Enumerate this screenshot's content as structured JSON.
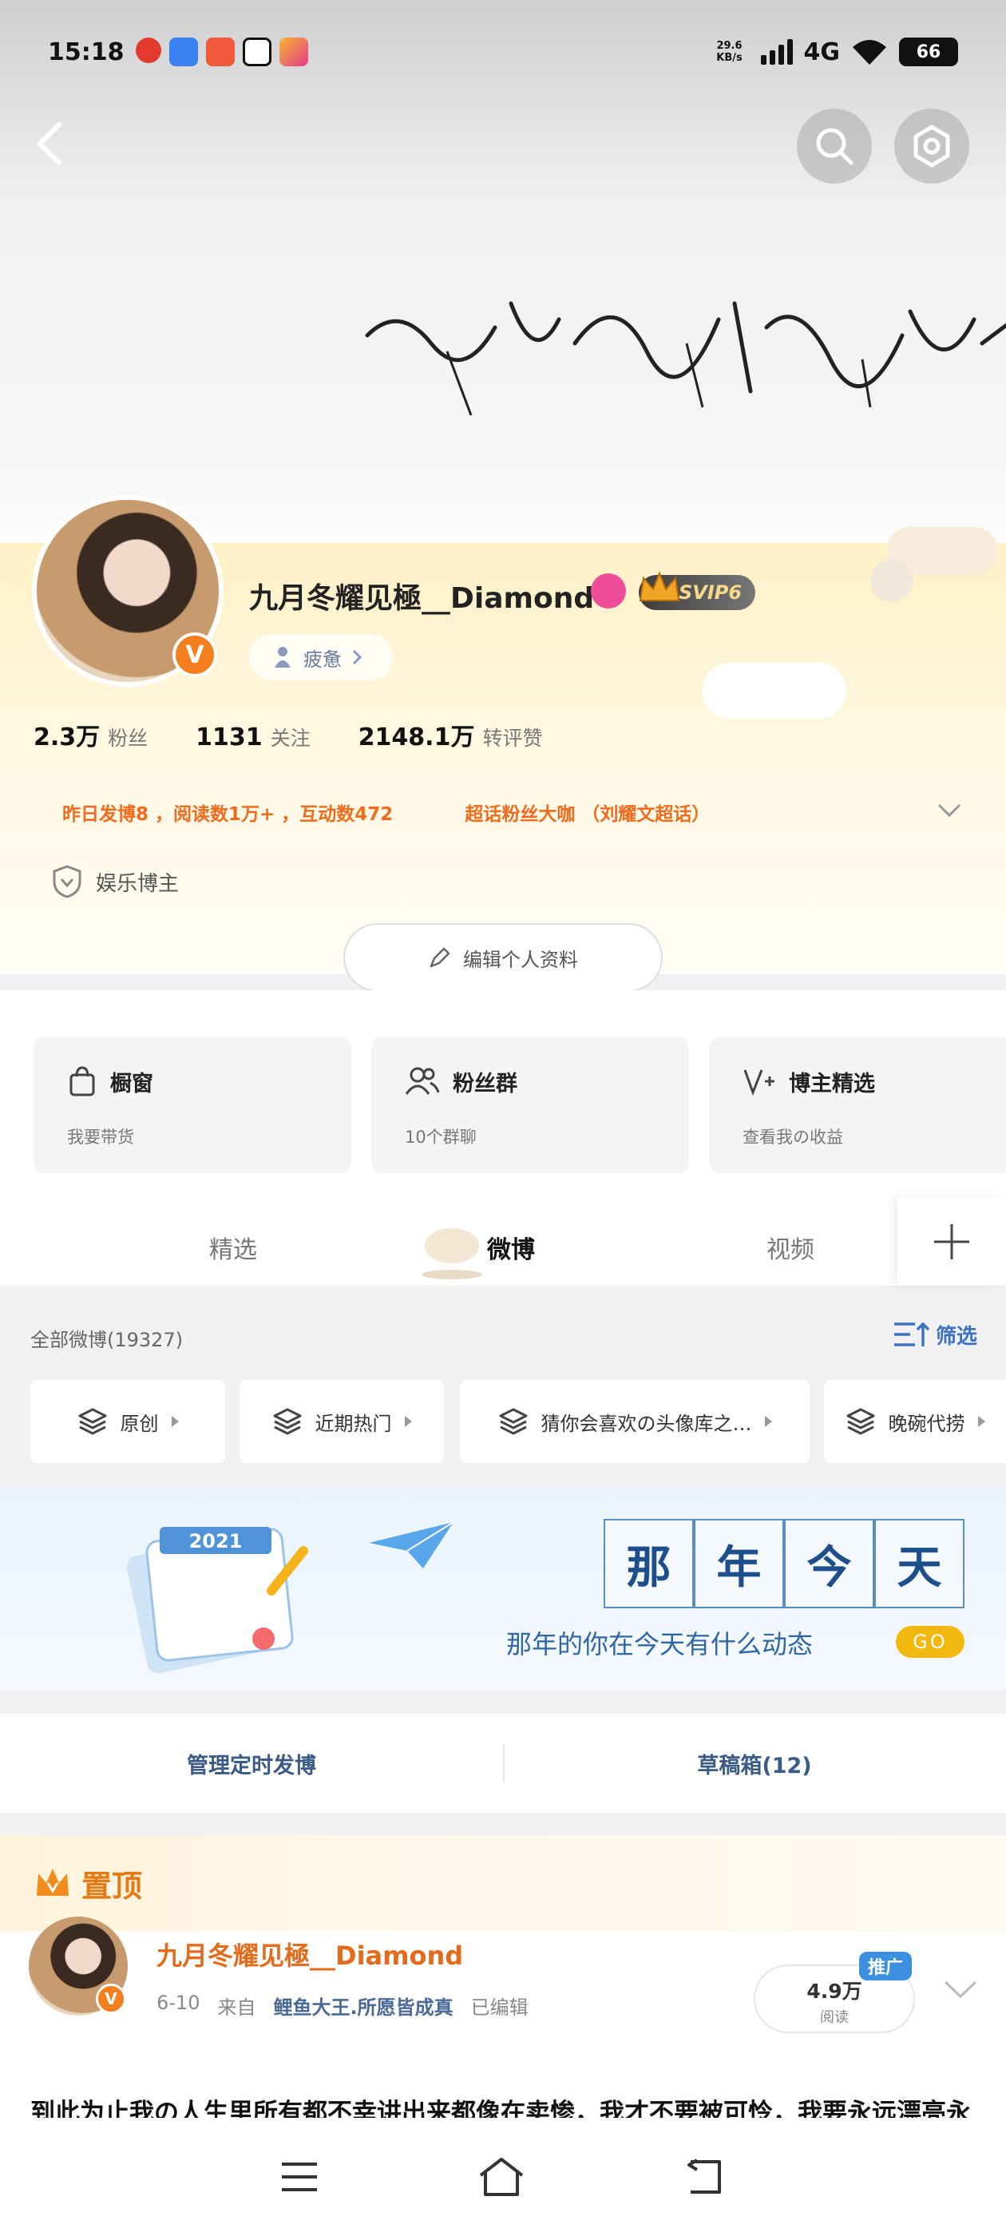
{
  "status_bar": {
    "time": "15:18",
    "net_speed_value": "29.6",
    "net_speed_unit": "KB/s",
    "network": "4G",
    "battery": "66"
  },
  "header": {
    "back_icon": "chevron-left-icon",
    "search_icon": "search-icon",
    "settings_icon": "gear-icon",
    "cover_calligraphy": "我想怎样就怎样"
  },
  "profile": {
    "name": "九月冬耀见極__Diamond",
    "vip_label": "SVIP6",
    "mood_label": "疲惫",
    "stats": [
      {
        "value": "2.3万",
        "label": "粉丝"
      },
      {
        "value": "1131",
        "label": "关注"
      },
      {
        "value": "2148.1万",
        "label": "转评赞"
      }
    ],
    "activity": "昨日发博8 ，阅读数1万+ ，互动数472",
    "super_topic": "超话粉丝大咖 （刘耀文超话）",
    "category": "娱乐博主",
    "edit_button": "编辑个人资料"
  },
  "cards": [
    {
      "title": "橱窗",
      "subtitle": "我要带货",
      "icon": "shopping-bag-icon"
    },
    {
      "title": "粉丝群",
      "subtitle": "10个群聊",
      "icon": "group-icon"
    },
    {
      "title": "博主精选",
      "subtitle": "查看我の收益",
      "icon": "verified-pen-icon"
    }
  ],
  "tabs": {
    "items": [
      "精选",
      "微博",
      "视频"
    ],
    "active": "微博"
  },
  "feed": {
    "total_label": "全部微博(19327)",
    "filter_label": "筛选",
    "chips": [
      "原创",
      "近期热门",
      "猜你会喜欢の头像库之…",
      "晚碗代捞"
    ]
  },
  "banner": {
    "year": "2021",
    "title_chars": [
      "那",
      "年",
      "今",
      "天"
    ],
    "subtitle": "那年的你在今天有什么动态",
    "go": "GO"
  },
  "manage": {
    "scheduled": "管理定时发博",
    "drafts": "草稿箱(12)"
  },
  "pinned": {
    "header": "置顶",
    "author": "九月冬耀见極__Diamond",
    "date": "6-10",
    "from_label": "来自",
    "source": "鲤鱼大王.所愿皆成真",
    "edited": "已编辑",
    "reads_value": "4.9万",
    "reads_label": "阅读",
    "promo": "推广",
    "text": "到此为止我の人生里所有都不幸讲出来都像在卖惨，我才不要被可怜，我要永远漂亮永"
  },
  "colors": {
    "accent_orange": "#f26a1b",
    "link_blue": "#3b73c2",
    "vip_gold": "#f8d88a"
  }
}
